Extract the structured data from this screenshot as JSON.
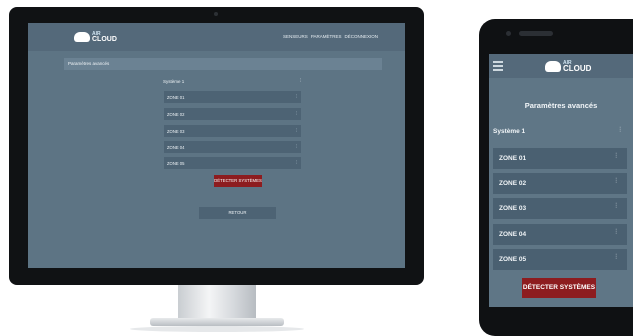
{
  "app": {
    "logo_small": "AIR",
    "logo_main": "CLOUD"
  },
  "desktop": {
    "nav": [
      "SENSEURS",
      "PARAMÈTRES",
      "DÉCONNEXION"
    ],
    "breadcrumb": "Paramètres avancés",
    "system_label": "Système 1",
    "zones": [
      "ZONE 01",
      "ZONE 02",
      "ZONE 03",
      "ZONE 04",
      "ZONE 05"
    ],
    "detect_button": "DÉTECTER SYSTÈMES",
    "back_button": "RETOUR"
  },
  "mobile": {
    "page_title": "Paramètres avancés",
    "system_label": "Système 1",
    "zones": [
      "ZONE 01",
      "ZONE 02",
      "ZONE 03",
      "ZONE 04",
      "ZONE 05"
    ],
    "detect_button": "DÉTECTER SYSTÈMES"
  },
  "icons": {
    "settings": "sliders-icon",
    "menu": "hamburger-icon",
    "logo": "cloud-logo-icon"
  },
  "colors": {
    "screen_bg": "#5d7484",
    "navbar": "#54697a",
    "zone_row": "#4d6374",
    "detect_red": "#8d1c1f"
  }
}
